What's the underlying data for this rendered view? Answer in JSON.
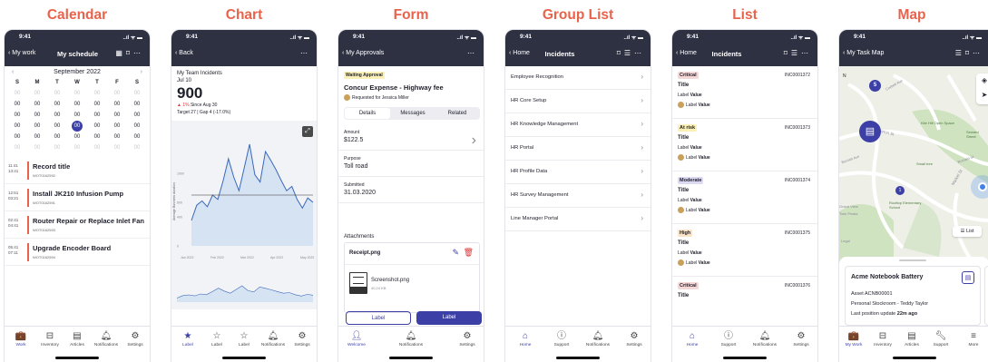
{
  "titles": {
    "calendar": "Calendar",
    "chart": "Chart",
    "form": "Form",
    "group": "Group List",
    "list": "List",
    "map": "Map"
  },
  "status": {
    "time": "9:41",
    "icons": "..ıl ᯤ ▬"
  },
  "calendar": {
    "back": "My work",
    "title": "My schedule",
    "month": "September 2022",
    "days": [
      "S",
      "M",
      "T",
      "W",
      "T",
      "F",
      "S"
    ],
    "grid": [
      [
        "00",
        "00",
        "00",
        "00",
        "00",
        "00",
        "00"
      ],
      [
        "00",
        "00",
        "00",
        "00",
        "00",
        "00",
        "00"
      ],
      [
        "00",
        "00",
        "00",
        "00",
        "00",
        "00",
        "00"
      ],
      [
        "00",
        "00",
        "00",
        "00",
        "00",
        "00",
        "00"
      ],
      [
        "00",
        "00",
        "00",
        "00",
        "00",
        "00",
        "00"
      ],
      [
        "00",
        "00",
        "00",
        "00",
        "00",
        "00",
        "00"
      ]
    ],
    "events": [
      {
        "t1": "11:41",
        "t2": "13:41",
        "title": "Record title",
        "code": "WOT0162592"
      },
      {
        "t1": "12:51",
        "t2": "03:21",
        "title": "Install JK210 Infusion Pump",
        "code": "WOT0162591"
      },
      {
        "t1": "02:41",
        "t2": "04:41",
        "title": "Router Repair or Replace Inlet Fan",
        "code": "WOT0162593"
      },
      {
        "t1": "05:41",
        "t2": "07:11",
        "title": "Upgrade Encoder Board",
        "code": "WOT0162594"
      }
    ],
    "tabs": [
      "Work",
      "Inventory",
      "Articles",
      "Notifications",
      "Settings"
    ]
  },
  "chart": {
    "back": "Back",
    "label": "My Team Incidents",
    "date": "Jul 10",
    "value": "900",
    "change": "1%",
    "since": "Since Aug 30",
    "target": "Target 27 | Gap 4 (-17.0%)",
    "tabs": [
      "Label",
      "Label",
      "Label",
      "Notifications",
      "Settings"
    ],
    "chart_data": {
      "type": "line",
      "ylabel": "Average Business duration",
      "yticks": [
        0,
        400,
        600,
        1000
      ],
      "xticks": [
        "Jan 2022",
        "Feb 2022",
        "Mar 2022",
        "Apr 2022",
        "May 2022"
      ],
      "values": [
        350,
        560,
        620,
        540,
        700,
        640,
        900,
        1200,
        950,
        760,
        1080,
        1400,
        980,
        880,
        1300,
        1180,
        1050,
        900,
        760,
        820,
        640,
        520,
        660,
        600
      ],
      "target": 700
    }
  },
  "form": {
    "back": "My Approvals",
    "status": "Waiting Approval",
    "title": "Concur Expense - Highway fee",
    "requested": "Requested for Jessica Miller",
    "tabs": [
      "Details",
      "Messages",
      "Related"
    ],
    "fields": [
      {
        "label": "Amount",
        "value": "$122.5"
      },
      {
        "label": "Purpose",
        "value": "Toll road"
      },
      {
        "label": "Submitted",
        "value": "31.03.2020"
      }
    ],
    "attachments": "Attachments",
    "file1": "Receipt.png",
    "file2": "Screenshot.png",
    "file2size": "40.24 KB",
    "btn1": "Label",
    "btn2": "Label",
    "tabbar": [
      "Welcome",
      "Notifications",
      "Settings"
    ]
  },
  "group": {
    "back": "Home",
    "title": "Incidents",
    "items": [
      "Employee Recognition",
      "HR Core Setup",
      "HR Knowledge Management",
      "HR Portal",
      "HR Profile Data",
      "HR Survey Management",
      "Line Manager Portal"
    ],
    "tabs": [
      "Home",
      "Support",
      "Notifications",
      "Settings"
    ]
  },
  "list": {
    "back": "Home",
    "title": "Incidents",
    "items": [
      {
        "badge": "Critical",
        "code": "INC0001372",
        "title": "Title",
        "label": "Label",
        "value": "Value"
      },
      {
        "badge": "At risk",
        "code": "INC0001373",
        "title": "Title",
        "label": "Label",
        "value": "Value"
      },
      {
        "badge": "Moderate",
        "code": "INC0001374",
        "title": "Title",
        "label": "Label",
        "value": "Value"
      },
      {
        "badge": "High",
        "code": "INC0001375",
        "title": "Title",
        "label": "Label",
        "value": "Value"
      },
      {
        "badge": "Critical",
        "code": "INC0001376",
        "title": "Title"
      }
    ],
    "colors": {
      "Critical": "#f6d7d7",
      "At risk": "#fbf0b6",
      "Moderate": "#dcd9f3",
      "High": "#fbe3c6"
    },
    "tabs": [
      "Home",
      "Support",
      "Notifications",
      "Settings"
    ]
  },
  "map": {
    "back": "My Task Map",
    "pin1": "5",
    "pin2": "1",
    "labels": [
      "Clayton St",
      "Kite Hill Open Space",
      "Seward Street",
      "Small tree",
      "Burnett Ave",
      "Grand View",
      "Rooftop Elementary School",
      "Twin Peaks",
      "Legal",
      "Corbett Ave",
      "Market St",
      "Romain St"
    ],
    "listbtn": "List",
    "card": {
      "title": "Acme Notebook Battery",
      "asset": "Asset ACNB00001",
      "stock": "Personal Stockroom - Teddy Taylor",
      "update": "Last position update",
      "ago": "22m ago"
    },
    "tabs": [
      "My Work",
      "Inventory",
      "Articles",
      "Support",
      "More"
    ]
  }
}
